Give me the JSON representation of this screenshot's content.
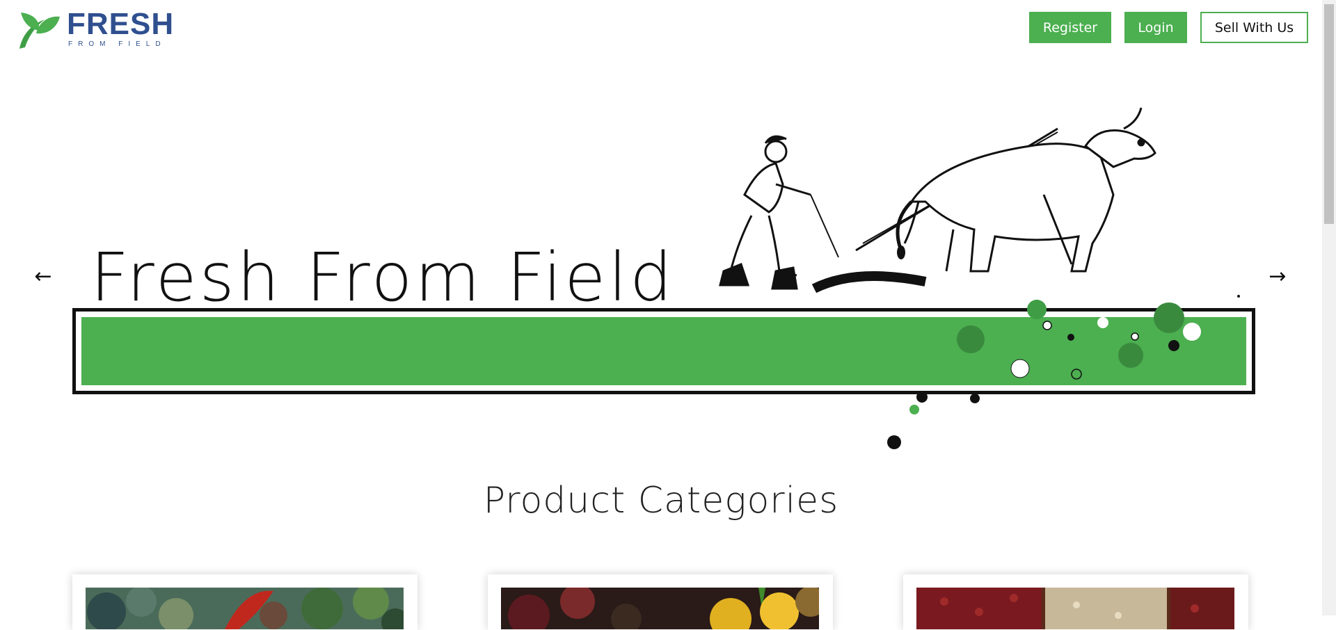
{
  "brand": {
    "name": "FRESH",
    "tagline": "FROM FIELD",
    "colors": {
      "primary": "#4caf50",
      "brand_blue": "#2f4f8f",
      "leaf": "#4caf50"
    }
  },
  "header": {
    "register_label": "Register",
    "login_label": "Login",
    "sell_label": "Sell With Us"
  },
  "hero": {
    "title": "Fresh From Field",
    "prev_icon": "arrow-left-icon",
    "next_icon": "arrow-right-icon",
    "prev_glyph": "←",
    "next_glyph": "→",
    "illustration": "farmer-plowing-with-ox-illustration"
  },
  "categories": {
    "title": "Product Categories",
    "cards": [
      {
        "image": "vegetables-assorted-photo"
      },
      {
        "image": "fruits-peppers-photo"
      },
      {
        "image": "grains-pulses-photo"
      }
    ]
  }
}
